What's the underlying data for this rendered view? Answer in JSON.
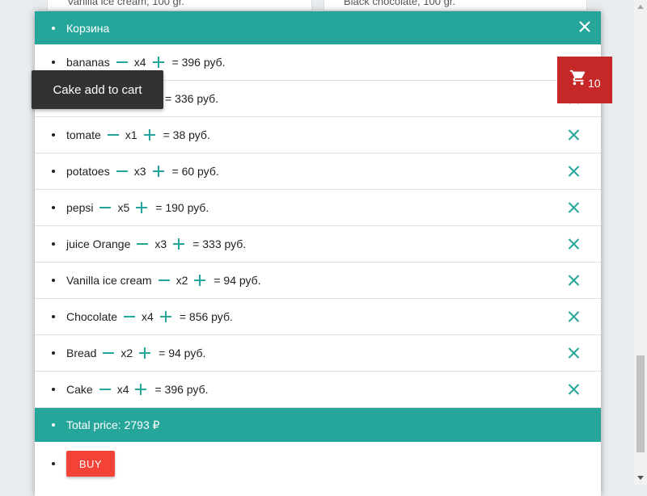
{
  "background": {
    "left_card": "Vanilla ice cream, 100 gr.",
    "right_card": "Black chocolate, 100 gr."
  },
  "cart": {
    "title": "Корзина",
    "currency_label": "руб.",
    "items": [
      {
        "name": "bananas",
        "qty": "x4",
        "total": "= 396 руб."
      },
      {
        "name": "",
        "qty": "",
        "total": "= 336 руб."
      },
      {
        "name": "tomate",
        "qty": "x1",
        "total": "= 38 руб."
      },
      {
        "name": "potatoes",
        "qty": "x3",
        "total": "= 60 руб."
      },
      {
        "name": "pepsi",
        "qty": "x5",
        "total": "= 190 руб."
      },
      {
        "name": "juice Orange",
        "qty": "x3",
        "total": "= 333 руб."
      },
      {
        "name": "Vanilla ice cream",
        "qty": "x2",
        "total": "= 94 руб."
      },
      {
        "name": "Chocolate",
        "qty": "x4",
        "total": "= 856 руб."
      },
      {
        "name": "Bread",
        "qty": "x2",
        "total": "= 94 руб."
      },
      {
        "name": "Cake",
        "qty": "x4",
        "total": "= 396 руб."
      }
    ],
    "total_label": "Total price: 2793 ₽",
    "buy_label": "BUY"
  },
  "toast": {
    "message": "Cake add to cart"
  },
  "cart_badge": {
    "count": "10",
    "icon": "shopping-cart-icon"
  },
  "colors": {
    "accent": "#26a69a",
    "buy": "#f44336",
    "badge": "#c62828",
    "toast": "#323232"
  }
}
